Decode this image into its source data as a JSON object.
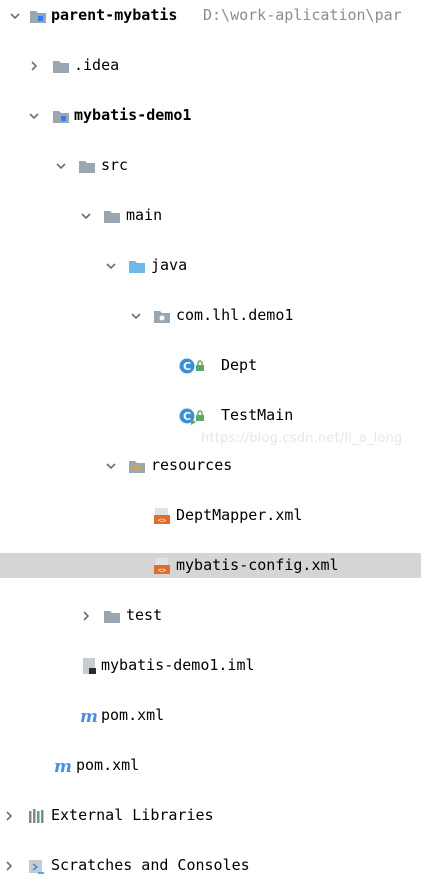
{
  "tree": {
    "root_label": "parent-mybatis",
    "root_path": "D:\\work-aplication\\par",
    "idea_folder": ".idea",
    "module_label": "mybatis-demo1",
    "src_folder": "src",
    "main_folder": "main",
    "java_folder": "java",
    "package_name": "com.lhl.demo1",
    "class_dept": "Dept",
    "class_testmain": "TestMain",
    "resources_folder": "resources",
    "file_deptmapper": "DeptMapper.xml",
    "file_mybatis_config": "mybatis-config.xml",
    "test_folder": "test",
    "file_iml": "mybatis-demo1.iml",
    "module_pom": "pom.xml",
    "root_pom": "pom.xml",
    "external_libraries": "External Libraries",
    "scratches": "Scratches and Consoles"
  },
  "watermark": "https://blog.csdn.net/li_a_long",
  "colors": {
    "folder": "#9aa7b0",
    "source_folder": "#6fb9e8",
    "selection": "#d5d5d5",
    "class_icon": "#3b8fd6",
    "xml_icon": "#e36b2b",
    "maven_icon": "#4b8fde"
  }
}
